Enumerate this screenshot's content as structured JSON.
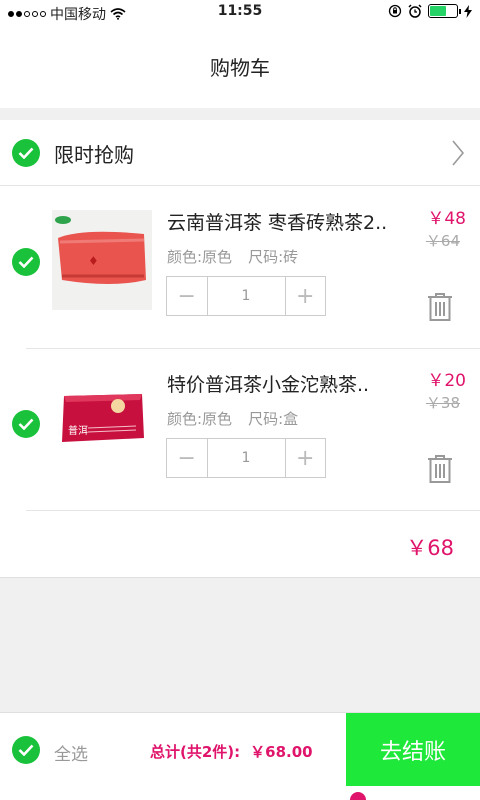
{
  "status_bar": {
    "carrier": "中国移动",
    "time": "11:55"
  },
  "header": {
    "title": "购物车"
  },
  "group": {
    "title": "限时抢购"
  },
  "items": [
    {
      "title": "云南普洱茶 枣香砖熟茶2..",
      "color_label": "颜色:原色",
      "size_label": "尺码:砖",
      "quantity": "1",
      "price": "￥48",
      "old_price": "￥64"
    },
    {
      "title": "特价普洱茶小金沱熟茶..",
      "color_label": "颜色:原色",
      "size_label": "尺码:盒",
      "quantity": "1",
      "price": "￥20",
      "old_price": "￥38"
    }
  ],
  "stepper": {
    "minus": "−",
    "plus": "+"
  },
  "subtotal": "￥68",
  "footer": {
    "select_all": "全选",
    "total_label": "总计(共2件):",
    "total_amount": "￥68.00",
    "checkout": "去结账"
  },
  "colors": {
    "accent_green": "#19c23a",
    "checkout_green": "#1ee83a",
    "price_pink": "#e0146b"
  },
  "icons": {
    "check": "check-circle-icon",
    "arrow": "chevron-right-icon",
    "trash": "trash-icon",
    "wifi": "wifi-icon",
    "alarm": "alarm-icon",
    "lock": "rotation-lock-icon",
    "battery": "battery-icon"
  }
}
